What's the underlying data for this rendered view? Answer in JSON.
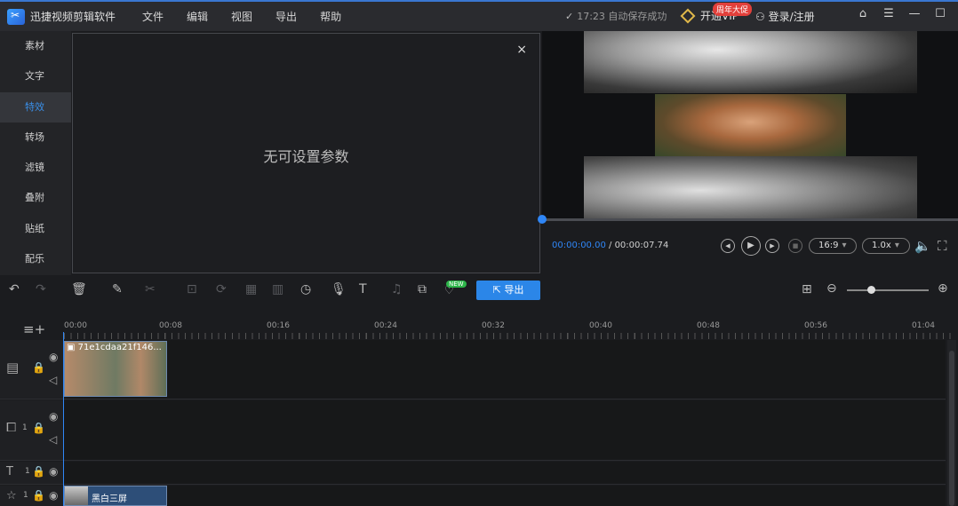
{
  "app": {
    "title": "迅捷视频剪辑软件"
  },
  "menu": [
    "文件",
    "编辑",
    "视图",
    "导出",
    "帮助"
  ],
  "status": {
    "save": "17:23 自动保存成功"
  },
  "vip": {
    "label": "开通VIP",
    "badge": "周年大促"
  },
  "account": {
    "login": "登录/注册"
  },
  "sidebar": {
    "items": [
      {
        "label": "素材"
      },
      {
        "label": "文字"
      },
      {
        "label": "特效"
      },
      {
        "label": "转场"
      },
      {
        "label": "滤镜"
      },
      {
        "label": "叠附"
      },
      {
        "label": "贴纸"
      },
      {
        "label": "配乐"
      }
    ],
    "active_index": 2
  },
  "settings_panel": {
    "message": "无可设置参数",
    "close": "×"
  },
  "player": {
    "current_time": "00:00:00.00",
    "separator": " / ",
    "total_time": "00:00:07.74",
    "aspect": "16:9",
    "speed": "1.0x"
  },
  "toolbar": {
    "export_label": "导出",
    "new_badge": "NEW"
  },
  "timeline": {
    "ruler": [
      "00:00",
      "00:08",
      "00:16",
      "00:24",
      "00:32",
      "00:40",
      "00:48",
      "00:56",
      "01:04"
    ],
    "video_clip": {
      "title": "71e1cdaa21f146..."
    },
    "pip_track_index": "1",
    "text_track_index": "1",
    "fx_track_index": "1",
    "fx_clip": {
      "label": "黑白三屏"
    }
  },
  "colors": {
    "accent": "#2f86f6",
    "export": "#2b86e8",
    "vip_badge": "#e2403b",
    "new_badge": "#2db54a"
  }
}
